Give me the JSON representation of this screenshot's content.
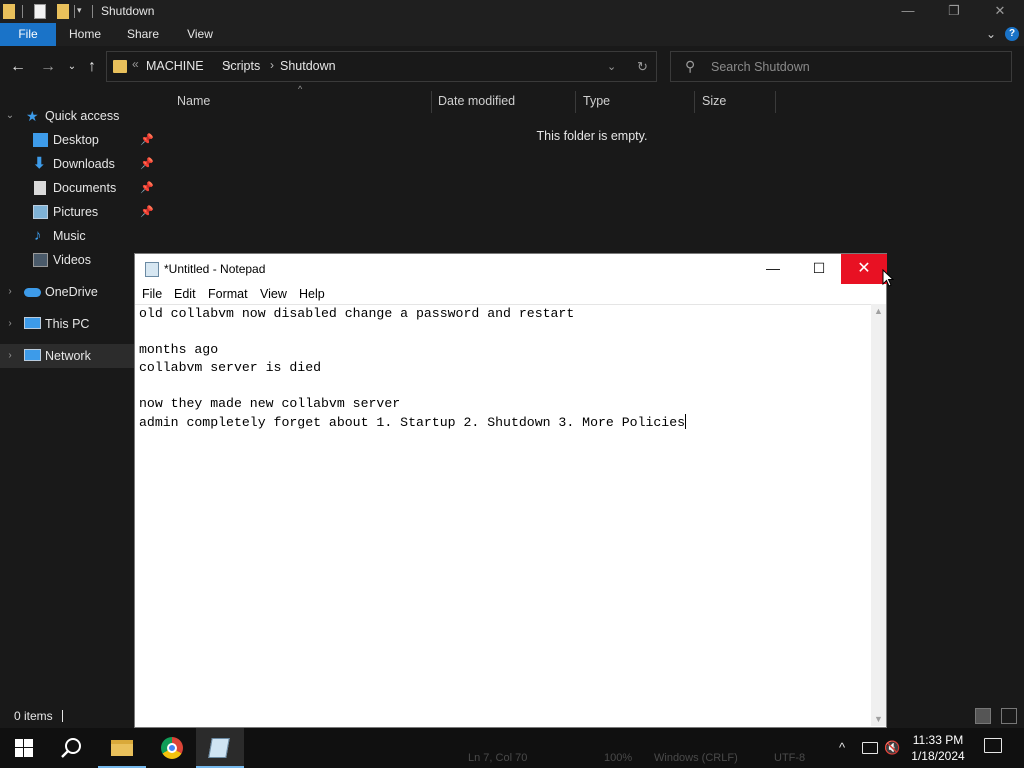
{
  "explorer": {
    "title": "Shutdown",
    "ribbon_tabs": [
      "File",
      "Home",
      "Share",
      "View"
    ],
    "breadcrumb": [
      "MACHINE",
      "Scripts",
      "Shutdown"
    ],
    "address_overflow": "«",
    "search_placeholder": "Search Shutdown",
    "columns": [
      "Name",
      "Date modified",
      "Type",
      "Size"
    ],
    "empty_message": "This folder is empty.",
    "status_count": "0 items",
    "sidebar": {
      "quick_access": "Quick access",
      "quick_items": [
        "Desktop",
        "Downloads",
        "Documents",
        "Pictures",
        "Music",
        "Videos"
      ],
      "onedrive": "OneDrive",
      "this_pc": "This PC",
      "network": "Network"
    }
  },
  "notepad": {
    "title": "*Untitled - Notepad",
    "menu": [
      "File",
      "Edit",
      "Format",
      "View",
      "Help"
    ],
    "lines": [
      "old collabvm now disabled change a password and restart",
      "",
      "months ago",
      "collabvm server is died",
      "",
      "now they made new collabvm server",
      "admin completely forget about 1. Startup 2. Shutdown 3. More Policies"
    ]
  },
  "notepad_statusbar_partial": [
    "Ln 7, Col 70",
    "100%",
    "Windows (CRLF)",
    "UTF-8"
  ],
  "taskbar": {
    "time": "11:33 PM",
    "date": "1/18/2024"
  },
  "colors": {
    "accent": "#1a73c8",
    "close_red": "#e81123",
    "folder_yellow": "#e9c05b"
  }
}
